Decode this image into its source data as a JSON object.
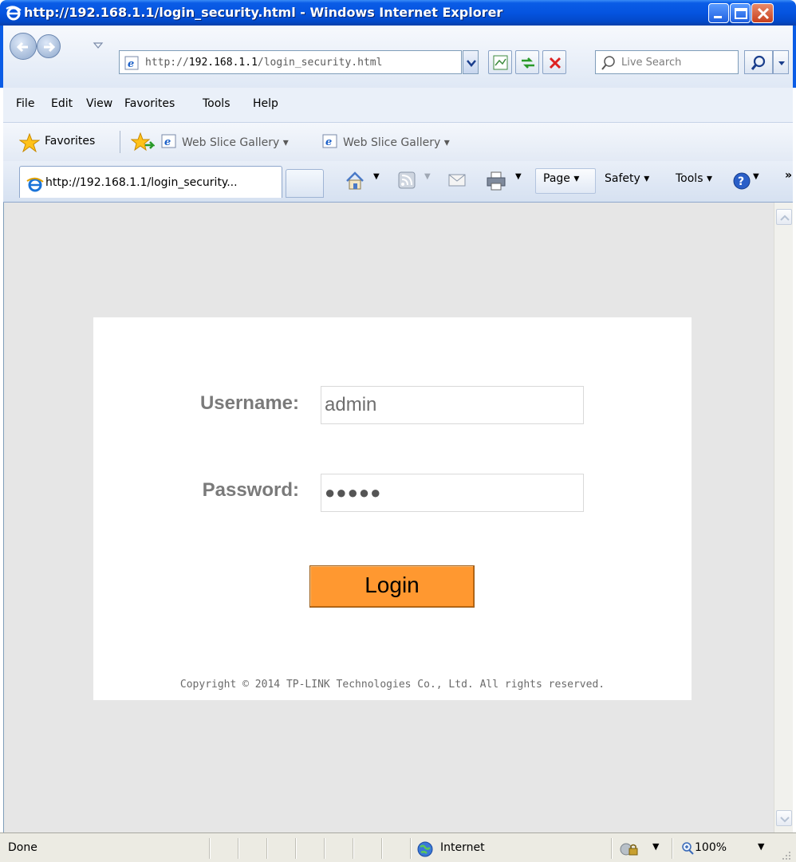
{
  "window": {
    "title": "http://192.168.1.1/login_security.html - Windows Internet Explorer"
  },
  "address": {
    "url_prefix": "http://",
    "url_host": "192.168.1.1",
    "url_path": "/login_security.html"
  },
  "search": {
    "placeholder": "Live Search"
  },
  "menu": {
    "file": "File",
    "edit": "Edit",
    "view": "View",
    "favorites": "Favorites",
    "tools": "Tools",
    "help": "Help"
  },
  "favorites_bar": {
    "label": "Favorites",
    "item1": "Web Slice Gallery",
    "item2": "Web Slice Gallery"
  },
  "tabs": {
    "active_label": "http://192.168.1.1/login_security..."
  },
  "command_bar": {
    "page": "Page",
    "safety": "Safety",
    "tools": "Tools"
  },
  "login": {
    "username_label": "Username:",
    "username_value": "admin",
    "password_label": "Password:",
    "password_mask": "●●●●●",
    "login_button": "Login",
    "copyright": "Copyright © 2014 TP-LINK Technologies Co., Ltd. All rights reserved."
  },
  "status": {
    "text": "Done",
    "zone": "Internet",
    "zoom": "100%"
  },
  "colors": {
    "login_button": "#ff9830",
    "label_gray": "#7a7a7a",
    "page_background": "#e6e6e6",
    "titlebar_blue": "#0554e0"
  }
}
